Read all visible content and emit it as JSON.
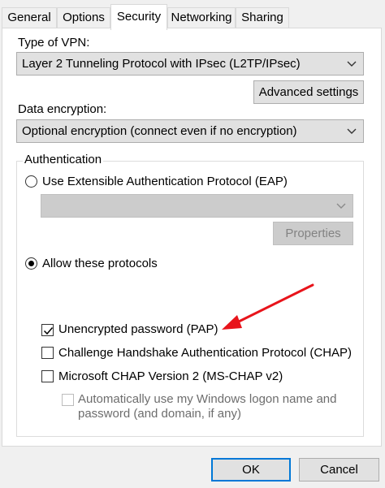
{
  "tabs": [
    {
      "label": "General",
      "active": false
    },
    {
      "label": "Options",
      "active": false
    },
    {
      "label": "Security",
      "active": true
    },
    {
      "label": "Networking",
      "active": false
    },
    {
      "label": "Sharing",
      "active": false
    }
  ],
  "vpn_type": {
    "label": "Type of VPN:",
    "selected": "Layer 2 Tunneling Protocol with IPsec (L2TP/IPsec)"
  },
  "advanced_settings_label": "Advanced settings",
  "data_encryption": {
    "label": "Data encryption:",
    "selected": "Optional encryption (connect even if no encryption)"
  },
  "authentication": {
    "legend": "Authentication",
    "eap_option": {
      "label": "Use Extensible Authentication Protocol (EAP)",
      "selected": false
    },
    "eap_dropdown": {
      "selected": "",
      "enabled": false
    },
    "properties_label": "Properties",
    "allow_option": {
      "label": "Allow these protocols",
      "selected": true
    },
    "protocols": [
      {
        "label": "Unencrypted password (PAP)",
        "checked": true
      },
      {
        "label": "Challenge Handshake Authentication Protocol (CHAP)",
        "checked": false
      },
      {
        "label": "Microsoft CHAP Version 2 (MS-CHAP v2)",
        "checked": false
      }
    ],
    "auto_logon": {
      "line1": "Automatically use my Windows logon name and",
      "line2": "password (and domain, if any)",
      "checked": false,
      "enabled": false
    }
  },
  "buttons": {
    "ok": "OK",
    "cancel": "Cancel"
  },
  "colors": {
    "accent": "#0078d7",
    "annotation_arrow": "#e8141b"
  },
  "icons": [
    "chevron-down-icon",
    "checkmark-icon",
    "red-arrow-annotation"
  ]
}
